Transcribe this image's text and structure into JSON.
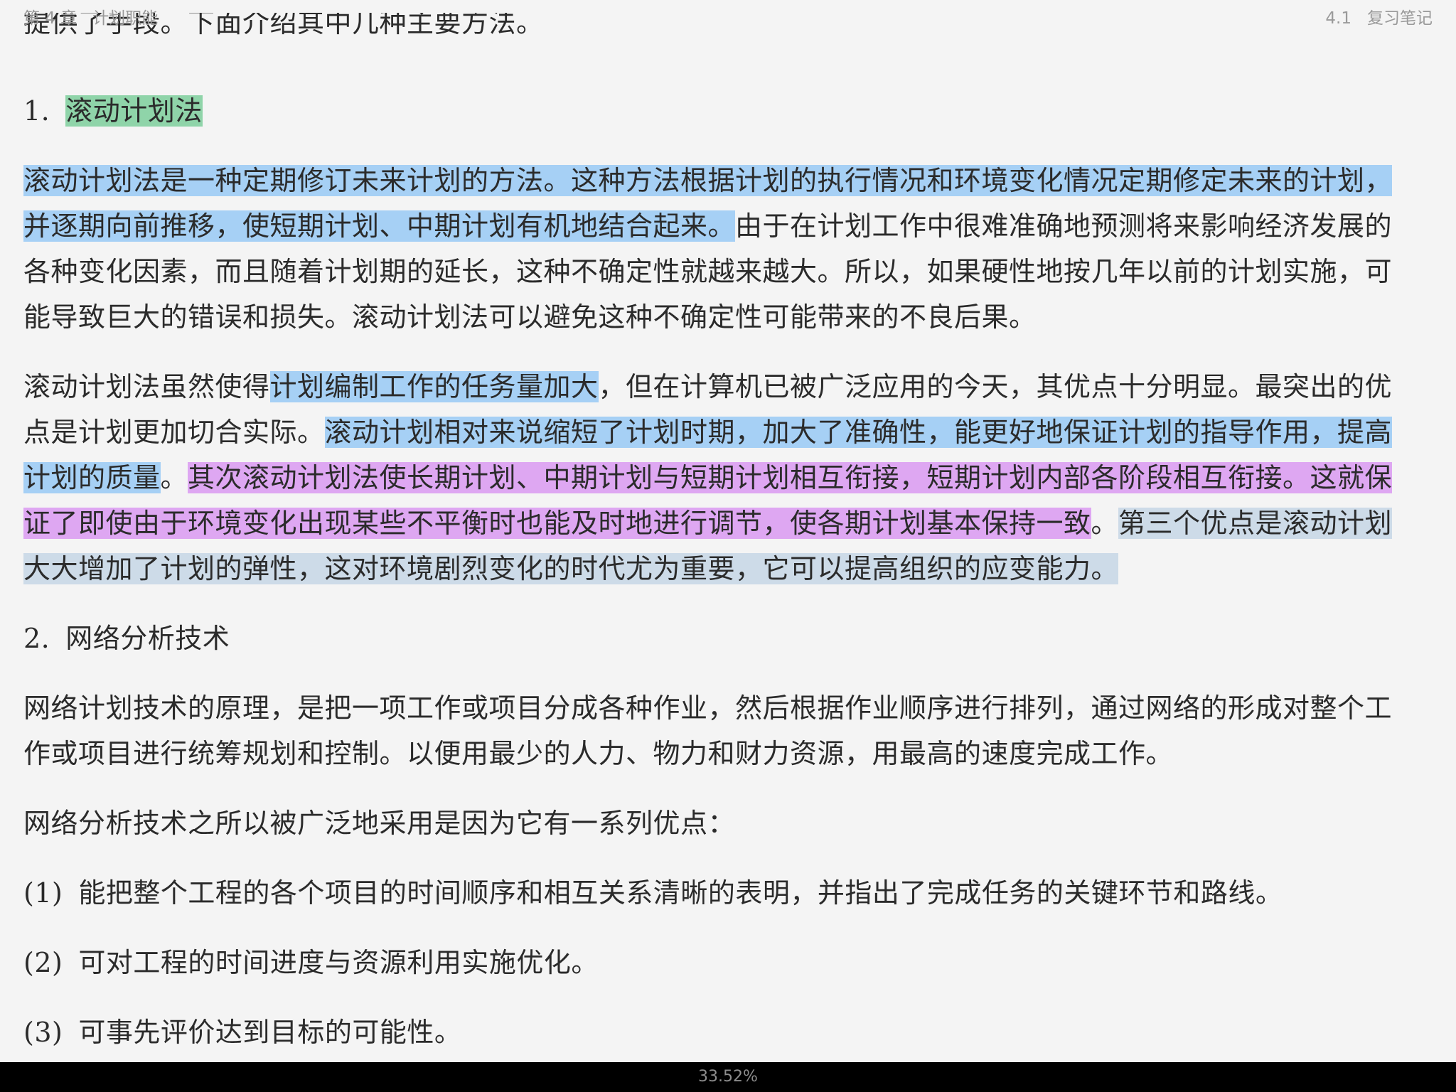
{
  "header": {
    "chapter": "第 4 章",
    "chapter_title": "计划职能",
    "section": "4.1",
    "section_title": "复习笔记"
  },
  "content": {
    "top_cut_line": "提供了手段。下面介绍其中几种主要方法。",
    "s1": {
      "number": "1.",
      "title": "滚动计划法"
    },
    "p1": {
      "hl": "滚动计划法是一种定期修订未来计划的方法。这种方法根据计划的执行情况和环境变化情况定期修定未来的计划，并逐期向前推移，使短期计划、中期计划有机地结合起来。",
      "rest": "由于在计划工作中很难准确地预测将来影响经济发展的各种变化因素，而且随着计划期的延长，这种不确定性就越来越大。所以，如果硬性地按几年以前的计划实施，可能导致巨大的错误和损失。滚动计划法可以避免这种不确定性可能带来的不良后果。"
    },
    "p2": {
      "a": "滚动计划法虽然使得",
      "hl1": "计划编制工作的任务量加大",
      "b": "，但在计算机已被广泛应用的今天，其优点十分明显。最突出的优点是计划更加切合实际。",
      "hl2": "滚动计划相对来说缩短了计划时期，加大了准确性，能更好地保证计划的指导作用，提高计划的质量",
      "c": "。",
      "hl3": "其次滚动计划法使长期计划、中期计划与短期计划相互衔接，短期计划内部各阶段相互衔接。这就保证了即使由于环境变化出现某些不平衡时也能及时地进行调节，使各期计划基本保持一致",
      "d": "。",
      "hl4": "第三个优点是滚动计划大大增加了计划的弹性，这对环境剧烈变化的时代尤为重要，它可以提高组织的应变能力。"
    },
    "s2": {
      "number": "2.",
      "title": "网络分析技术"
    },
    "p3": "网络计划技术的原理，是把一项工作或项目分成各种作业，然后根据作业顺序进行排列，通过网络的形成对整个工作或项目进行统筹规划和控制。以便用最少的人力、物力和财力资源，用最高的速度完成工作。",
    "p4": "网络分析技术之所以被广泛地采用是因为它有一系列优点：",
    "items": [
      {
        "num": "(1)",
        "text": "能把整个工程的各个项目的时间顺序和相互关系清晰的表明，并指出了完成任务的关键环节和路线。"
      },
      {
        "num": "(2)",
        "text": "可对工程的时间进度与资源利用实施优化。"
      },
      {
        "num": "(3)",
        "text": "可事先评价达到目标的可能性。"
      }
    ]
  },
  "footer": {
    "progress": "33.52%"
  }
}
